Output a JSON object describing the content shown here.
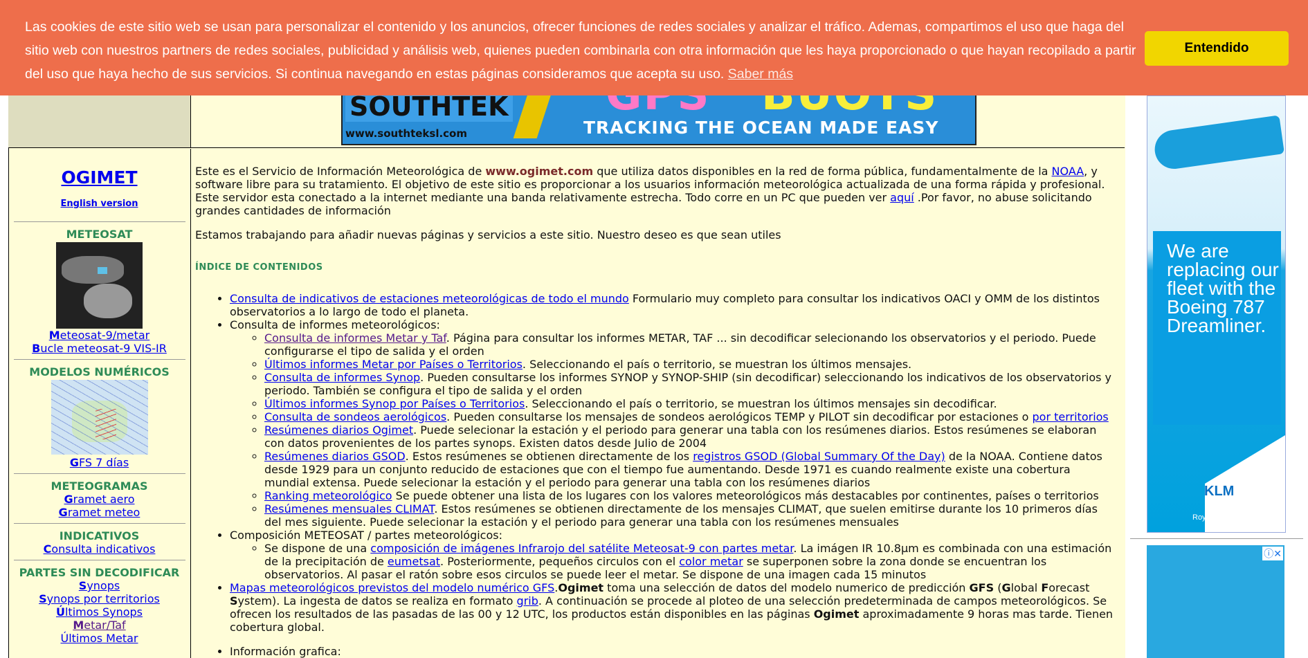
{
  "cookie": {
    "message": "Las cookies de este sitio web se usan para personalizar el contenido y los anuncios, ofrecer funciones de redes sociales y analizar el tráfico. Ademas, compartimos el uso que haga del sitio web con nuestros partners de redes sociales, publicidad y análisis web, quienes pueden combinarla con otra información que les haya proporcionado o que hayan recopilado a partir del uso que haya hecho de sus servicios. Si continua navegando en estas páginas consideramos que acepta su uso.",
    "learn_more": "Saber más",
    "accept": "Entendido"
  },
  "banner": {
    "brand": "SOUTHTEK",
    "url": "www.southteksl.com",
    "gps": "GPS",
    "buoys": "BUOYS",
    "tagline": "TRACKING THE OCEAN MADE EASY"
  },
  "sidebar": {
    "title": "OGIMET",
    "english": "English version",
    "meteosat": {
      "heading": "METEOSAT",
      "link1_first": "M",
      "link1_rest": "eteosat-9/metar",
      "link2_first": "B",
      "link2_rest": "ucle meteosat-9 VIS-IR"
    },
    "modelos": {
      "heading": "MODELOS NUMÉRICOS",
      "link_first": "G",
      "link_rest": "FS 7 días"
    },
    "meteogramas": {
      "heading": "METEOGRAMAS",
      "link1_first": "G",
      "link1_rest": "ramet aero",
      "link2_first": "G",
      "link2_rest": "ramet meteo"
    },
    "indicativos": {
      "heading": "INDICATIVOS",
      "link_first": "C",
      "link_rest": "onsulta indicativos"
    },
    "partes": {
      "heading": "PARTES SIN DECODIFICAR",
      "link1_first": "S",
      "link1_rest": "ynops",
      "link2_first": "S",
      "link2_rest": "ynops por territorios",
      "link3_first": "Ú",
      "link3_rest": "ltimos Synops",
      "link4_first": "M",
      "link4_rest": "etar/Taf",
      "link5": "Últimos Metar"
    }
  },
  "main": {
    "intro_a": "Este es el Servicio de Información Meteorológica de ",
    "intro_site": "www.ogimet.com",
    "intro_b": " que utiliza datos disponibles en la red de forma pública, fundamentalmente de la ",
    "intro_noaa": "NOAA",
    "intro_c": ", y software libre para su tratamiento. El objetivo de este sitio es proporcionar a los usuarios información meteorológica actualizada de una forma rápida y profesional. Este servidor esta conectado a la internet mediante una banda relativamente estrecha. Todo corre en un PC que pueden ver ",
    "intro_aqui": "aquí",
    "intro_d": " .Por favor, no abuse solicitando grandes cantidades de información",
    "p2": "Estamos trabajando para añadir nuevas páginas y servicios a este sitio. Nuestro deseo es que sean utiles",
    "index_title": "ÍNDICE DE CONTENIDOS",
    "item1_link": "Consulta de indicativos de estaciones meteorológicas de todo el mundo",
    "item1_text": " Formulario muy completo para consultar los indicativos OACI y OMM de los distintos observatorios a lo largo de todo el planeta.",
    "item2_text": "Consulta de informes meteorológicos:",
    "sub1_link": "Consulta de informes Metar y Taf",
    "sub1_text": ". Página para consultar los informes METAR, TAF ... sin decodificar selecionando los observatorios y el periodo. Puede configurarse el tipo de salida y el orden",
    "sub2_link": "Últimos informes Metar por Países o Territorios",
    "sub2_text": ". Seleccionando el país o territorio, se muestran los últimos mensajes.",
    "sub3_link": "Consulta de informes Synop",
    "sub3_text": ". Pueden consultarse los informes SYNOP y SYNOP-SHIP (sin decodificar) seleccionando los indicativos de los observatorios y periodo. También se configura el tipo de salida y el orden",
    "sub4_link": "Últimos informes Synop por Países o Territorios",
    "sub4_text": ". Seleccionando el país o territorio, se muestran los últimos mensajes sin decodificar.",
    "sub5_link": "Consulta de sondeos aerológicos",
    "sub5_text": ". Pueden consultarse los mensajes de sondeos aerológicos TEMP y PILOT sin decodificar por estaciones o ",
    "sub5_link2": "por territorios",
    "sub6_link": "Resúmenes diarios Ogimet",
    "sub6_text": ". Puede selecionar la estación y el periodo para generar una tabla con los resúmenes diarios. Estos resúmenes se elaboran con datos provenientes de los partes synops. Existen datos desde Julio de 2004",
    "sub7_link": "Resúmenes diarios GSOD",
    "sub7_text_a": ". Estos resúmenes se obtienen directamente de los ",
    "sub7_link2": "registros GSOD (Global Summary Of the Day)",
    "sub7_text_b": " de la NOAA. Contiene datos desde 1929 para un conjunto reducido de estaciones que con el tiempo fue aumentando. Desde 1971 es cuando realmente existe una cobertura mundial extensa. Puede selecionar la estación y el periodo para generar una tabla con los resúmenes diarios",
    "sub8_link": "Ranking meteorológico",
    "sub8_text": " Se puede obtener una lista de los lugares con los valores meteorológicos más destacables por continentes, países o territorios",
    "sub9_link": "Resúmenes mensuales CLIMAT",
    "sub9_text": ". Estos resúmenes se obtienen directamente de los mensajes CLIMAT, que suelen emitirse durante los 10 primeros días del mes siguiente. Puede selecionar la estación y el periodo para generar una tabla con los resúmenes mensuales",
    "item3_text": "Composición METEOSAT / partes meteorológicos:",
    "msub1_a": "Se dispone de una ",
    "msub1_link": "composición de imágenes Infrarojo del satélite Meteosat-9 con partes metar",
    "msub1_b": ". La imágen IR 10.8µm es combinada con una estimación de la precipitación de ",
    "msub1_link2": "eumetsat",
    "msub1_c": ". Posteriormente, pequeños circulos con el ",
    "msub1_link3": "color metar",
    "msub1_d": " se superponen sobre la zona donde se encuentran los observatorios. Al pasar el ratón sobre esos circulos se puede leer el metar. Se dispone de una imagen cada 15 minutos",
    "item4_link": "Mapas meteorológicos previstos del modelo numérico GFS",
    "item4_dot": ".",
    "item4_ogimet": "Ogimet",
    "item4_a": " toma una selección de datos del modelo numerico de predicción ",
    "item4_gfs": "GFS",
    "item4_b": " (",
    "item4_g": "G",
    "item4_c": "lobal ",
    "item4_f": "F",
    "item4_d": "orecast ",
    "item4_s": "S",
    "item4_e": "ystem). La ingesta de datos se realiza en formato ",
    "item4_grib": "grib",
    "item4_f2": ". A continuación se procede al ploteo de una selección predeterminada de campos meteorológicos. Se ofrecen los resultados de las pasadas de las 00 y 12 UTC, los productos están disponibles en las páginas ",
    "item4_ogimet2": "Ogimet",
    "item4_g2": " aproximadamente 9 horas mas tarde. Tienen cobertura global.",
    "item5_text": "Información grafica:"
  },
  "ad": {
    "text": "We are replacing our fleet with the Boeing 787 Dreamliner.",
    "klm": "KLM",
    "tagline": "Royal Dutch Airlines",
    "adchoices": "ⓘ✕"
  }
}
